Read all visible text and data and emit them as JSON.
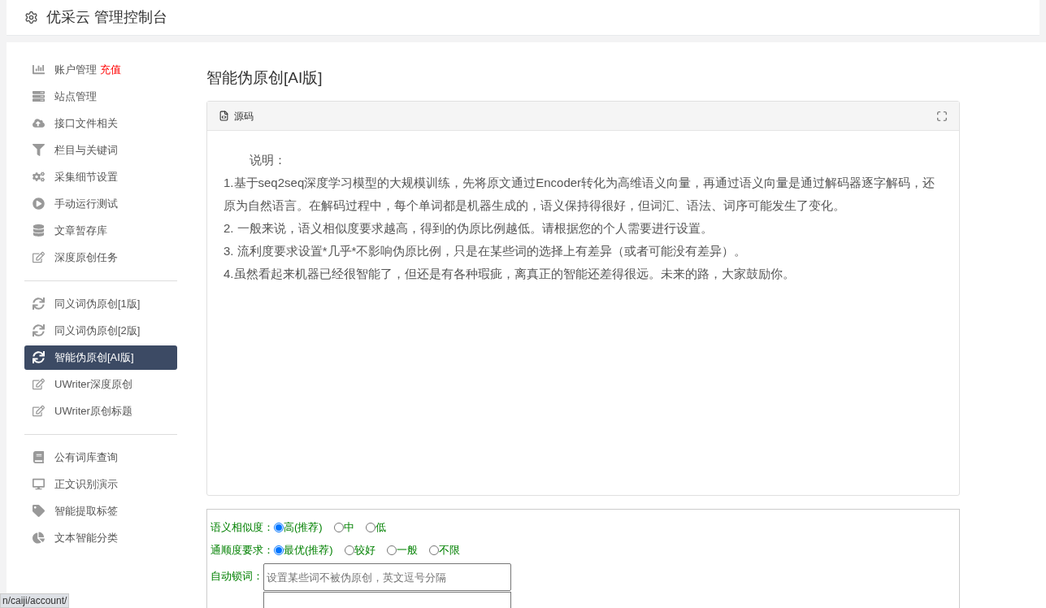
{
  "header": {
    "title": "优采云 管理控制台"
  },
  "sidebar": {
    "groups": [
      [
        {
          "label": "账户管理",
          "badge": "充值",
          "selected": false
        },
        {
          "label": "站点管理",
          "selected": false
        },
        {
          "label": "接口文件相关",
          "selected": false
        },
        {
          "label": "栏目与关键词",
          "selected": false
        },
        {
          "label": "采集细节设置",
          "selected": false
        },
        {
          "label": "手动运行测试",
          "selected": false
        },
        {
          "label": "文章暂存库",
          "selected": false
        },
        {
          "label": "深度原创任务",
          "selected": false
        }
      ],
      [
        {
          "label": "同义词伪原创[1版]",
          "selected": false
        },
        {
          "label": "同义词伪原创[2版]",
          "selected": false
        },
        {
          "label": "智能伪原创[AI版]",
          "selected": true
        },
        {
          "label": "UWriter深度原创",
          "selected": false
        },
        {
          "label": "UWriter原创标题",
          "selected": false
        }
      ],
      [
        {
          "label": "公有词库查询",
          "selected": false
        },
        {
          "label": "正文识别演示",
          "selected": false
        },
        {
          "label": "智能提取标签",
          "selected": false
        },
        {
          "label": "文本智能分类",
          "selected": false
        }
      ]
    ]
  },
  "page_title": "智能伪原创[AI版]",
  "editor": {
    "tab": "源码",
    "lines": [
      "说明：",
      "1.基于seq2seq深度学习模型的大规模训练，先将原文通过Encoder转化为高维语义向量，再通过语义向量是通过解码器逐字解码，还原为自然语言。在解码过程中，每个单词都是机器生成的，语义保持得很好，但词汇、语法、词序可能发生了变化。",
      "2. 一般来说，语义相似度要求越高，得到的伪原比例越低。请根据您的个人需要进行设置。",
      "3. 流利度要求设置*几乎*不影响伪原比例，只是在某些词的选择上有差异（或者可能没有差异）。",
      "4.虽然看起来机器已经很智能了，但还是有各种瑕疵，离真正的智能还差得很远。未来的路，大家鼓励你。"
    ]
  },
  "form": {
    "radio_groups": [
      {
        "label": "语义相似度：",
        "options": [
          {
            "label": "高(推荐)",
            "selected": true
          },
          {
            "label": "中",
            "selected": false
          },
          {
            "label": "低",
            "selected": false
          }
        ]
      },
      {
        "label": "通顺度要求：",
        "options": [
          {
            "label": "最优(推荐)",
            "selected": true
          },
          {
            "label": "较好",
            "selected": false
          },
          {
            "label": "一般",
            "selected": false
          },
          {
            "label": "不限",
            "selected": false
          }
        ]
      }
    ],
    "lock_words": {
      "label": "自动锁词：",
      "placeholder": "设置某些词不被伪原创，英文逗号分隔"
    }
  },
  "status_url": "n/caiji/account/"
}
